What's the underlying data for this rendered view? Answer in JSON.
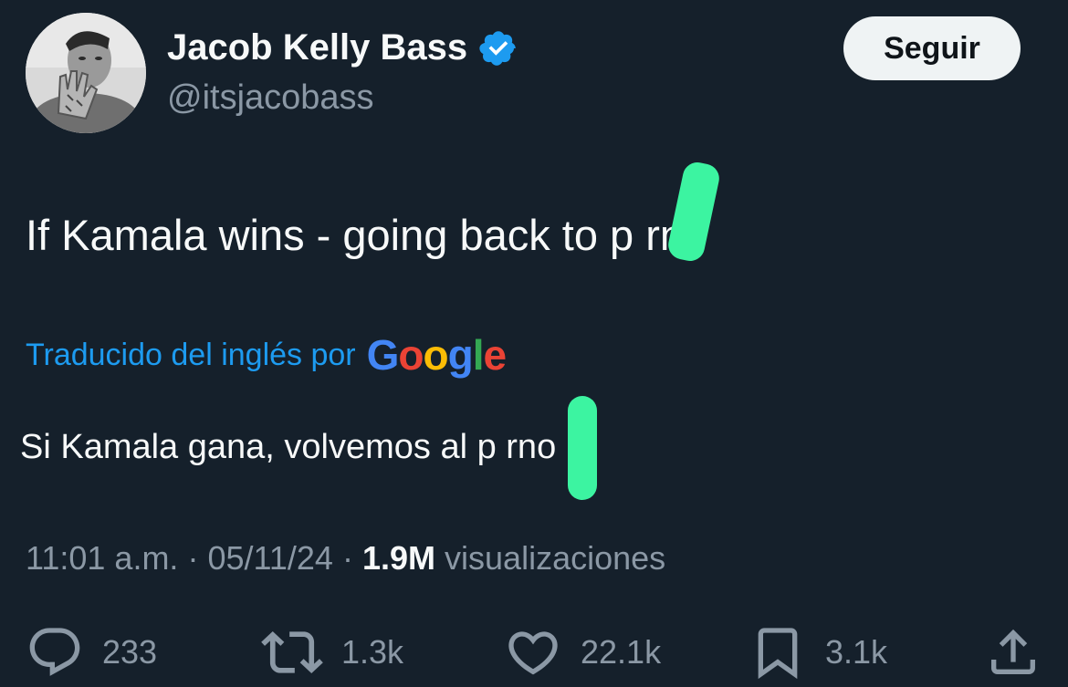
{
  "author": {
    "display_name": "Jacob Kelly Bass",
    "handle": "@itsjacobass",
    "verified": true
  },
  "follow_button": {
    "label": "Seguir"
  },
  "tweet": {
    "text": "If Kamala wins - going back to p  rn",
    "translation_label": "Traducido del inglés por",
    "translation_provider": "Google",
    "translated_text": "Si Kamala gana, volvemos al p  rno"
  },
  "meta": {
    "time": "11:01 a.m.",
    "separator": "·",
    "date": "05/11/24",
    "views_count": "1.9M",
    "views_label": "visualizaciones"
  },
  "actions": {
    "replies": "233",
    "reposts": "1.3k",
    "likes": "22.1k",
    "bookmarks": "3.1k"
  },
  "colors": {
    "background": "#15202b",
    "text_primary": "#f7f9f9",
    "text_secondary": "#8b98a5",
    "accent": "#1d9bf0",
    "censor_mark": "#3cf4a1"
  },
  "icons": {
    "verified": "verified-badge-icon",
    "reply": "reply-icon",
    "repost": "repost-icon",
    "like": "heart-icon",
    "bookmark": "bookmark-icon",
    "share": "share-icon"
  }
}
